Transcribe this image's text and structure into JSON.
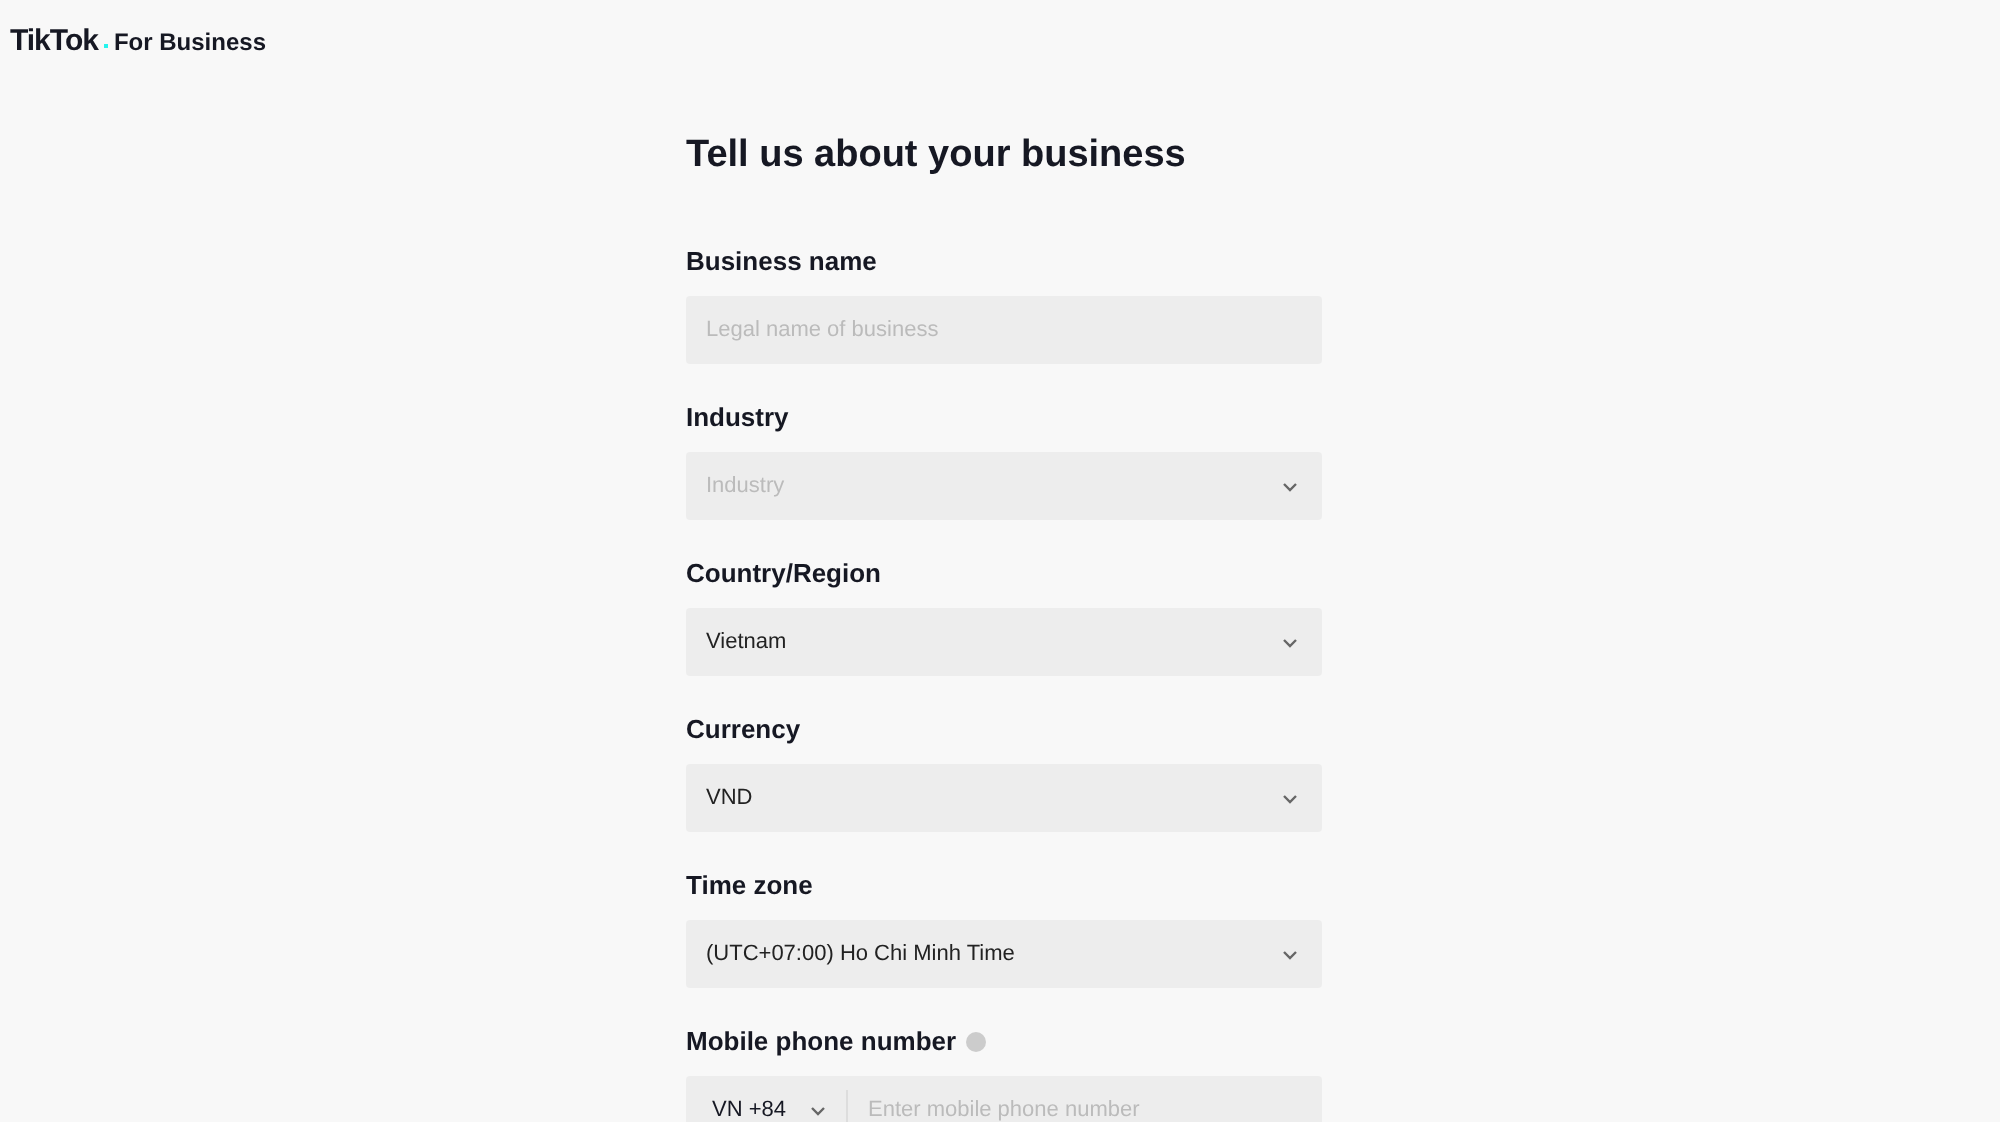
{
  "header": {
    "logo": "TikTok",
    "logo_suffix": "For Business"
  },
  "form": {
    "title": "Tell us about your business",
    "fields": [
      {
        "kind": "text",
        "label": "Business name",
        "placeholder": "Legal name of business"
      },
      {
        "kind": "select",
        "label": "Industry",
        "placeholder": "Industry"
      },
      {
        "kind": "select",
        "label": "Country/Region",
        "value": "Vietnam"
      },
      {
        "kind": "select",
        "label": "Currency",
        "value": "VND"
      },
      {
        "kind": "select",
        "label": "Time zone",
        "value": "(UTC+07:00) Ho Chi Minh Time"
      },
      {
        "kind": "phone",
        "label": "Mobile phone number",
        "help": true,
        "code": "VN +84",
        "placeholder": "Enter mobile phone number"
      }
    ]
  }
}
